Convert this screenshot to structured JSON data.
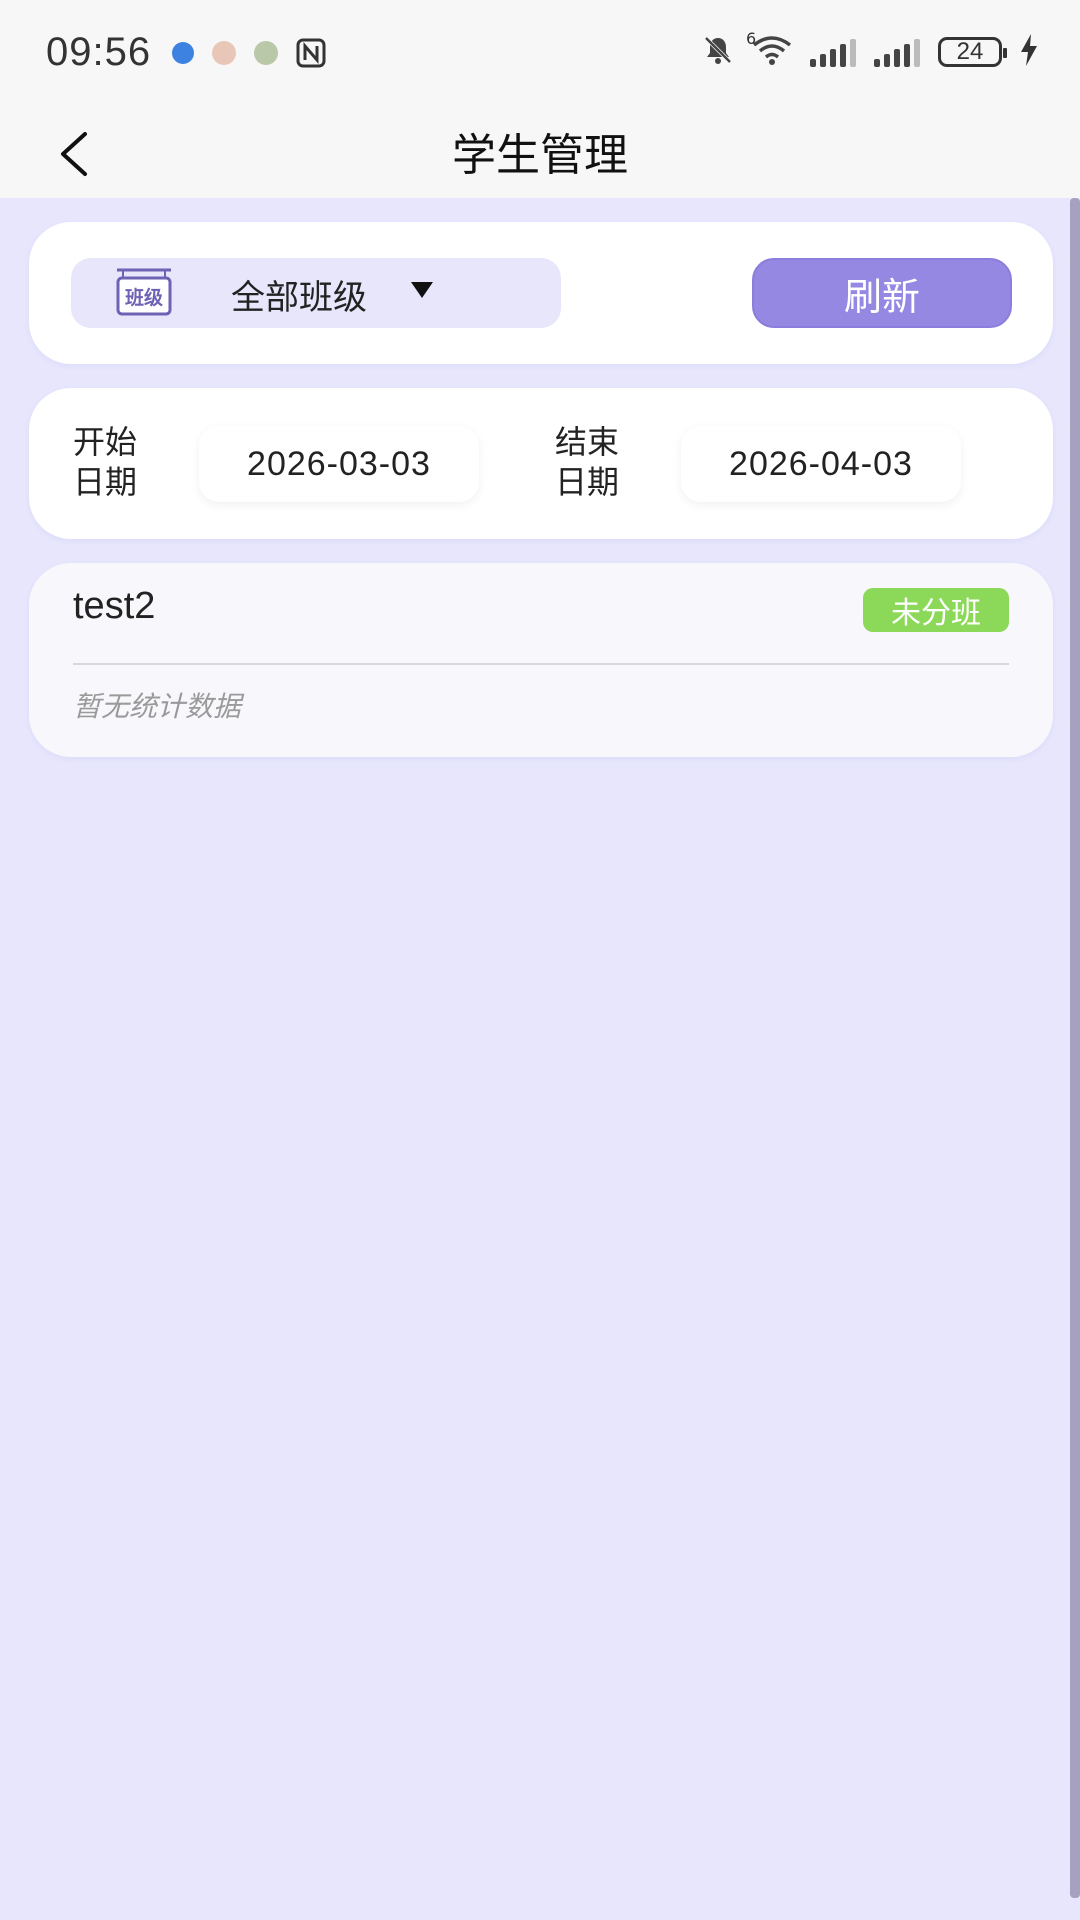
{
  "status_bar": {
    "time": "09:56",
    "network_label": "6",
    "battery": "24",
    "icons": [
      "app-notification-icon",
      "app-notification-icon",
      "app-notification-icon",
      "nfc-icon",
      "mute-icon",
      "wifi-icon",
      "signal-icon",
      "signal-icon",
      "battery-icon",
      "charging-icon"
    ]
  },
  "header": {
    "title": "学生管理"
  },
  "filter": {
    "class_icon_text": "班级",
    "class_selected": "全部班级",
    "refresh_label": "刷新"
  },
  "dates": {
    "start_label_line1": "开始",
    "start_label_line2": "日期",
    "start_value": "2026-03-03",
    "end_label_line1": "结束",
    "end_label_line2": "日期",
    "end_value": "2026-04-03"
  },
  "students": [
    {
      "name": "test2",
      "status": "未分班",
      "stats_text": "暂无统计数据"
    }
  ],
  "colors": {
    "background": "#e7e6fd",
    "accent": "#9588e3",
    "badge": "#8cd95a"
  }
}
